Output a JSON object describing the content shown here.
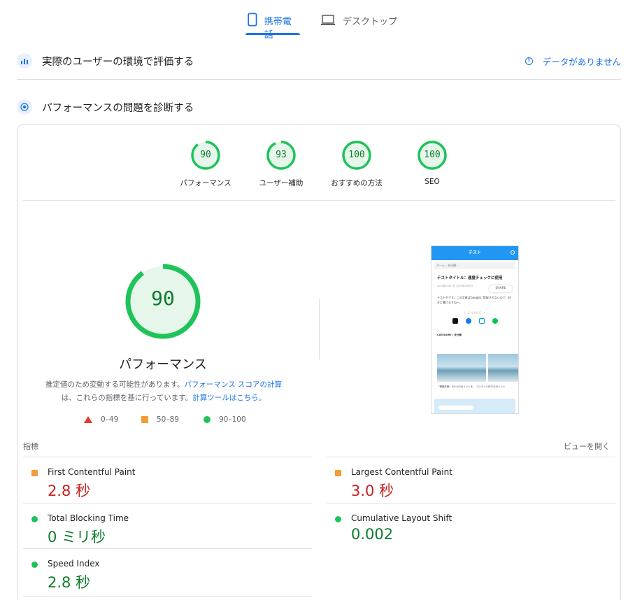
{
  "tabs": {
    "mobile": "携帯電話",
    "desktop": "デスクトップ"
  },
  "field_section": {
    "title": "実際のユーザーの環境で評価する",
    "no_data": "データがありません"
  },
  "lab_section": {
    "title": "パフォーマンスの問題を診断する"
  },
  "scores": [
    {
      "value": 90,
      "label": "パフォーマンス"
    },
    {
      "value": 93,
      "label": "ユーザー補助"
    },
    {
      "value": 100,
      "label": "おすすめの方法"
    },
    {
      "value": 100,
      "label": "SEO"
    }
  ],
  "performance": {
    "score": 90,
    "title": "パフォーマンス",
    "desc_1": "推定値のため変動する可能性があります。",
    "desc_link_1": "パフォーマンス スコアの計算",
    "desc_2": "は、これらの指標を基に行っています。",
    "desc_link_2": "計算ツールはこちら。"
  },
  "legend": {
    "poor": "0–49",
    "average": "50–89",
    "good": "90–100"
  },
  "screenshot": {
    "header": "テスト",
    "crumb": "ホーム › 未分類 ›",
    "title": "テストタイトル：速度チェックに使用",
    "meta": "2024年2月27日  2024年4月5日",
    "share_btn": "SHARE",
    "body": "テストやです。この文章はGoogleに登録されないので、好きに書けますねー。",
    "share_heading": "\\ SHARE /",
    "category": "CATEGORY | 未分類",
    "caption": "「骨格診断」の5つのポイントを...  コンテンツ作りのポイント"
  },
  "metrics": {
    "label": "指標",
    "toggle": "ビューを開く",
    "fcp": {
      "name": "First Contentful Paint",
      "value": "2.8 秒",
      "status": "average"
    },
    "lcp": {
      "name": "Largest Contentful Paint",
      "value": "3.0 秒",
      "status": "average"
    },
    "tbt": {
      "name": "Total Blocking Time",
      "value": "0 ミリ秒",
      "status": "good"
    },
    "cls": {
      "name": "Cumulative Layout Shift",
      "value": "0.002",
      "status": "good"
    },
    "si": {
      "name": "Speed Index",
      "value": "2.8 秒",
      "status": "good"
    }
  },
  "colors": {
    "accent": "#1a73e8",
    "good": "#0c7c2c",
    "good_ring": "#1ec35a",
    "average": "#f29d38",
    "poor": "#e53935"
  }
}
